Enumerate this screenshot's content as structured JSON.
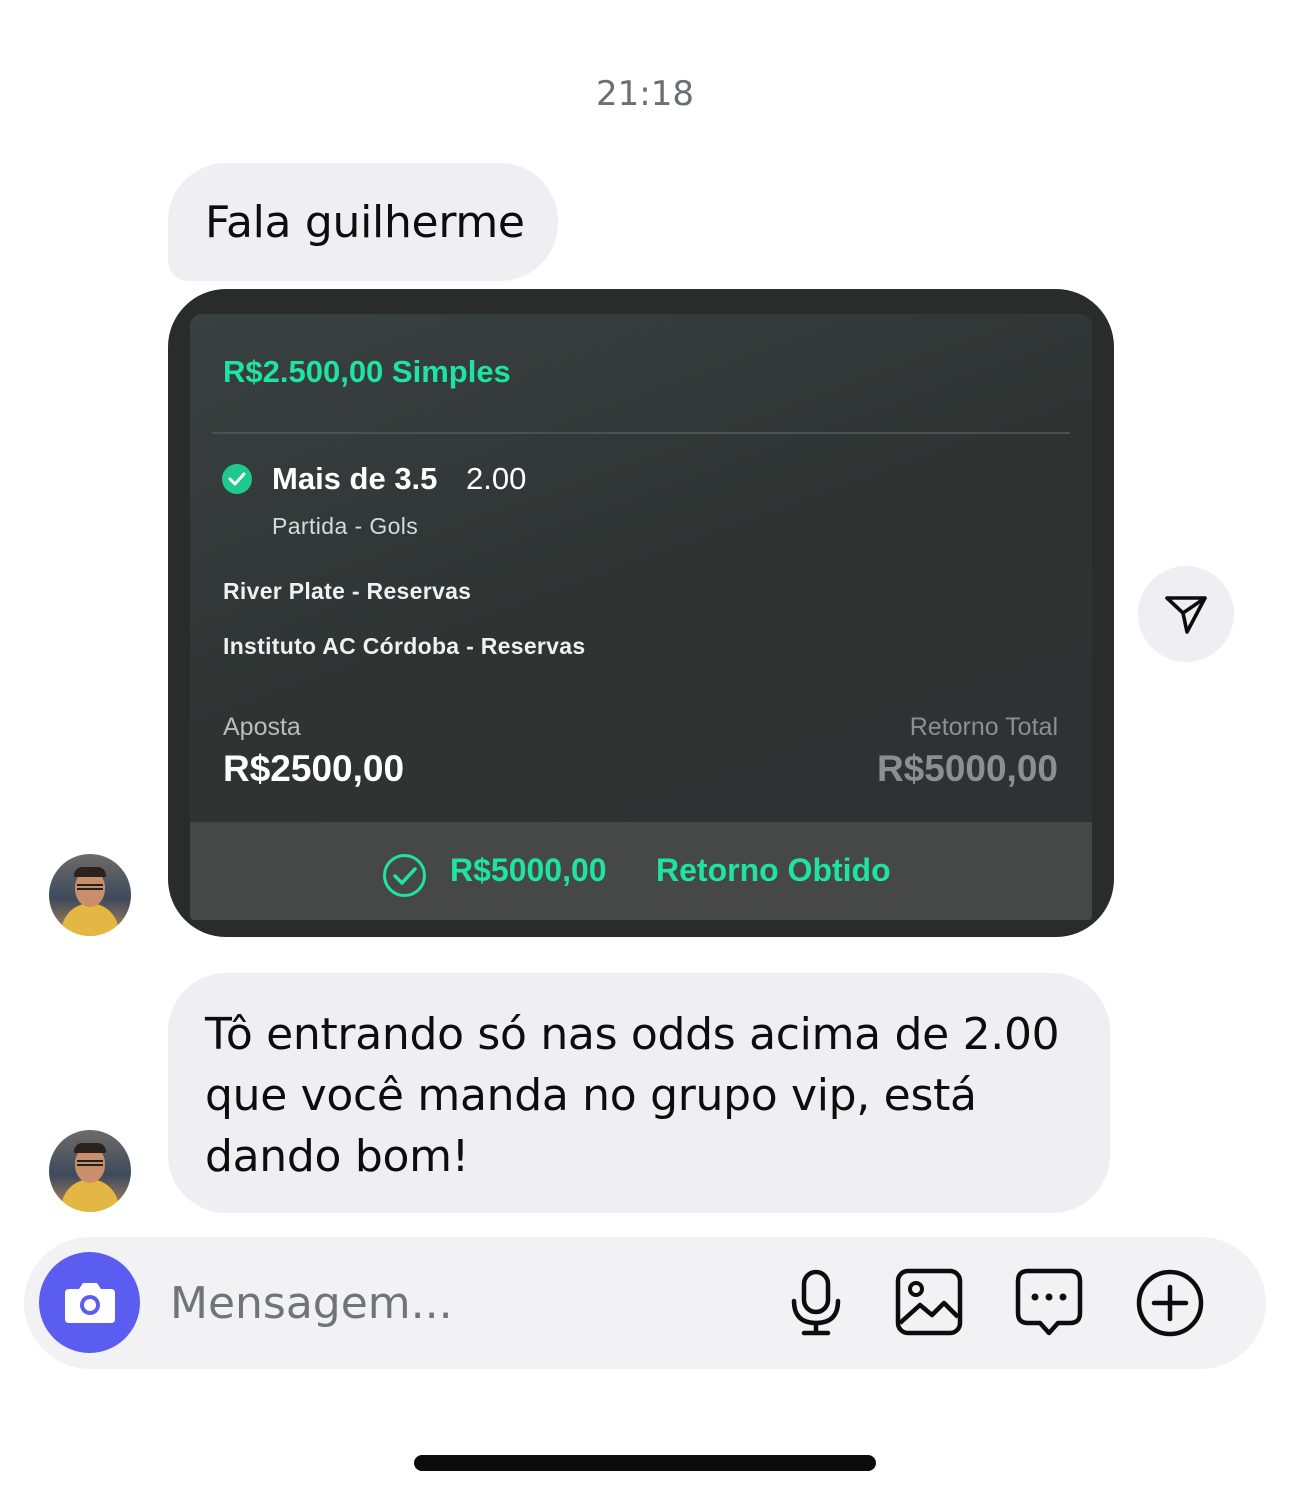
{
  "chat": {
    "timestamp": "21:18",
    "messages": [
      {
        "text": "Fala guilherme"
      },
      {
        "text": "Tô entrando só nas odds acima de 2.00 que você manda no grupo vip, está dando bom!"
      }
    ]
  },
  "bet_slip": {
    "title": "R$2.500,00 Simples",
    "selection": "Mais de 3.5",
    "odd": "2.00",
    "market": "Partida - Gols",
    "team_home": "River Plate - Reservas",
    "team_away": "Instituto AC Córdoba - Reservas",
    "stake_label": "Aposta",
    "stake_value": "R$2500,00",
    "return_label": "Retorno Total",
    "return_value": "R$5000,00",
    "result_amount": "R$5000,00",
    "result_label": "Retorno Obtido",
    "accent_color": "#1fe3a0"
  },
  "composer": {
    "placeholder": "Mensagem...",
    "accent_color": "#5b5cf0",
    "icons": [
      "camera-icon",
      "microphone-icon",
      "gallery-icon",
      "sticker-icon",
      "plus-icon"
    ]
  }
}
